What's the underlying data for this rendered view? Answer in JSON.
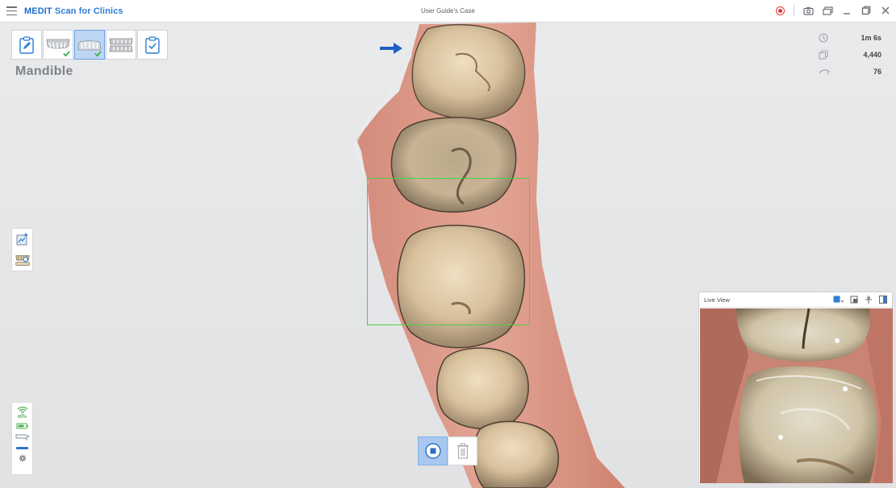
{
  "app": {
    "title_brand": "MEDIT",
    "title_rest": "Scan for Clinics",
    "case_title": "User Guide's Case"
  },
  "stages": [
    {
      "name": "note",
      "active": false,
      "completed": false
    },
    {
      "name": "maxilla",
      "active": false,
      "completed": true
    },
    {
      "name": "mandible",
      "active": true,
      "completed": true
    },
    {
      "name": "occlusion",
      "active": false,
      "completed": false
    },
    {
      "name": "review",
      "active": false,
      "completed": false
    }
  ],
  "stage_label": "Mandible",
  "stats": {
    "time": "1m 6s",
    "frames": "4,440",
    "rate": "76"
  },
  "status": {
    "wifi_percent": "65%"
  },
  "live_view": {
    "title": "Live View"
  },
  "colors": {
    "accent": "#2f7dd6",
    "scan_box": "#4ccf4c",
    "record": "#e23b3b",
    "gum": "#d98b78"
  }
}
